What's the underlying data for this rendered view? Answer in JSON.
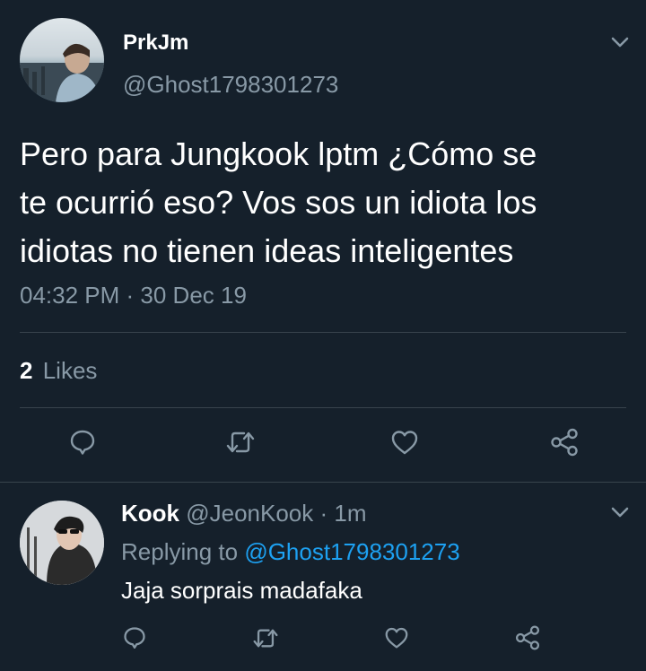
{
  "colors": {
    "background": "#15202b",
    "divider": "#38444d",
    "muted_text": "#8899a6",
    "link": "#1da1f2",
    "primary_text": "#ffffff"
  },
  "main_tweet": {
    "display_name": "PrkJm",
    "handle": "@Ghost1798301273",
    "text_lines": [
      "Pero para Jungkook lptm ¿Cómo se",
      "te ocurrió eso? Vos sos un idiota los",
      "idiotas no tienen ideas inteligentes"
    ],
    "timestamp": "04:32 PM · 30 Dec 19",
    "likes_count": "2",
    "likes_label": "Likes"
  },
  "reply": {
    "display_name": "Kook",
    "handle": "@JeonKook",
    "separator": "·",
    "time": "1m",
    "replying_prefix": "Replying to",
    "replying_handle": "@Ghost1798301273",
    "text": "Jaja sorprais madafaka"
  },
  "icons": {
    "reply": "reply-icon",
    "retweet": "retweet-icon",
    "like": "heart-icon",
    "share": "share-icon",
    "more": "chevron-down-icon"
  }
}
